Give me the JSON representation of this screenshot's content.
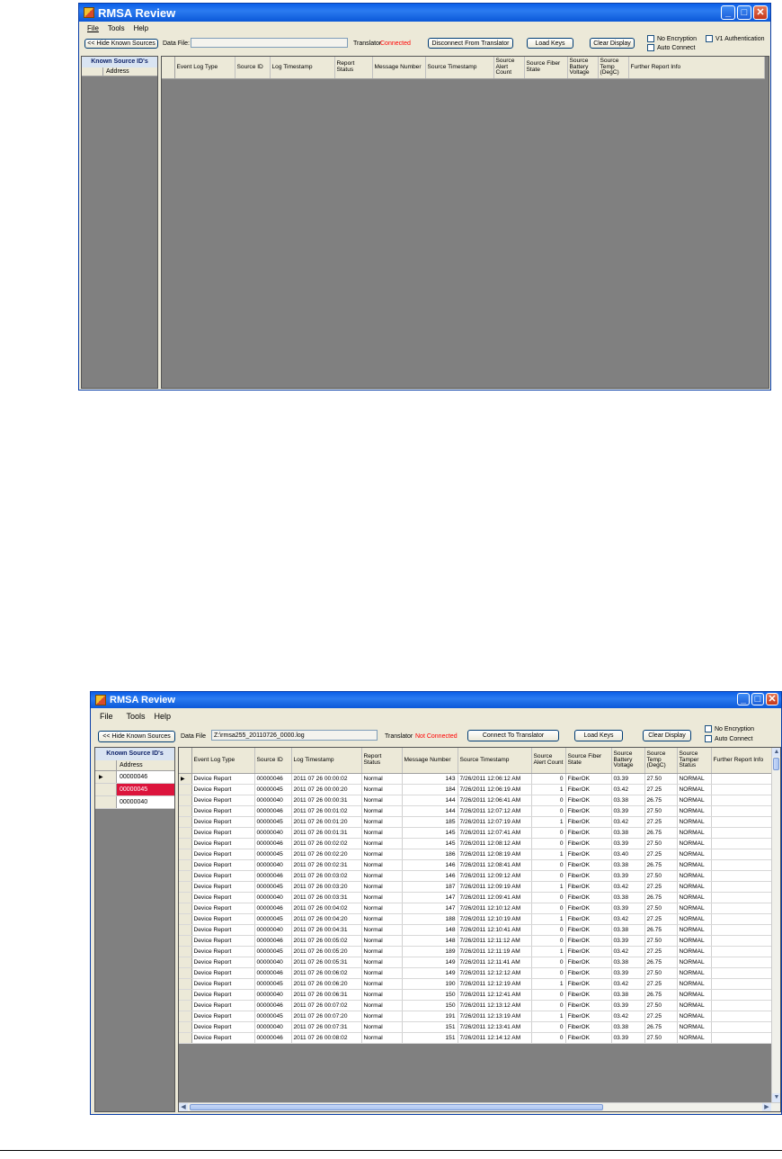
{
  "screen1": {
    "title": "RMSA Review",
    "menu": [
      "File",
      "Tools",
      "Help"
    ],
    "hide_button": "<< Hide Known Sources",
    "data_file_label": "Data File:",
    "data_file_value": "",
    "translator_label": "Translator",
    "translator_status": "Connected",
    "connect_button": "Disconnect From Translator",
    "load_keys": "Load Keys",
    "clear_display": "Clear Display",
    "no_encryption": "No Encryption",
    "auto_connect": "Auto Connect",
    "v1_auth": "V1 Authentication",
    "known_sources_title": "Known Source ID's",
    "address_header": "Address",
    "columns": [
      "Event Log Type",
      "Source ID",
      "Log Timestamp",
      "Report Status",
      "Message Number",
      "Source Timestamp",
      "Source Alert Count",
      "Source Fiber State",
      "Source Battery Voltage",
      "Source Temp (DegC)",
      "Further Report Info"
    ]
  },
  "screen2": {
    "title": "RMSA Review",
    "menu": [
      "File",
      "Tools",
      "Help"
    ],
    "hide_button": "<< Hide Known Sources",
    "data_file_label": "Data File",
    "data_file_value": "Z:\\rmsa255_20110726_0000.log",
    "translator_label": "Translator",
    "translator_status": "Not Connected",
    "connect_button": "Connect To Translator",
    "load_keys": "Load Keys",
    "clear_display": "Clear Display",
    "no_encryption": "No Encryption",
    "auto_connect": "Auto Connect",
    "known_sources_title": "Known Source ID's",
    "address_header": "Address",
    "sources": [
      "00000046",
      "00000045",
      "00000040"
    ],
    "columns": [
      "Event Log Type",
      "Source ID",
      "Log Timestamp",
      "Report Status",
      "Message Number",
      "Source Timestamp",
      "Source Alert Count",
      "Source Fiber State",
      "Source Battery Voltage",
      "Source Temp (DegC)",
      "Source Tamper Status",
      "Further Report Info"
    ],
    "rows": [
      [
        "Device Report",
        "00000046",
        "2011 07 26 00:00:02",
        "Normal",
        "143",
        "7/26/2011 12:06:12 AM",
        "0",
        "FiberOK",
        "03.39",
        "27.50",
        "NORMAL",
        ""
      ],
      [
        "Device Report",
        "00000045",
        "2011 07 26 00:00:20",
        "Normal",
        "184",
        "7/26/2011 12:06:19 AM",
        "1",
        "FiberOK",
        "03.42",
        "27.25",
        "NORMAL",
        ""
      ],
      [
        "Device Report",
        "00000040",
        "2011 07 26 00:00:31",
        "Normal",
        "144",
        "7/26/2011 12:06:41 AM",
        "0",
        "FiberOK",
        "03.38",
        "26.75",
        "NORMAL",
        ""
      ],
      [
        "Device Report",
        "00000046",
        "2011 07 26 00:01:02",
        "Normal",
        "144",
        "7/26/2011 12:07:12 AM",
        "0",
        "FiberOK",
        "03.39",
        "27.50",
        "NORMAL",
        ""
      ],
      [
        "Device Report",
        "00000045",
        "2011 07 26 00:01:20",
        "Normal",
        "185",
        "7/26/2011 12:07:19 AM",
        "1",
        "FiberOK",
        "03.42",
        "27.25",
        "NORMAL",
        ""
      ],
      [
        "Device Report",
        "00000040",
        "2011 07 26 00:01:31",
        "Normal",
        "145",
        "7/26/2011 12:07:41 AM",
        "0",
        "FiberOK",
        "03.38",
        "26.75",
        "NORMAL",
        ""
      ],
      [
        "Device Report",
        "00000046",
        "2011 07 26 00:02:02",
        "Normal",
        "145",
        "7/26/2011 12:08:12 AM",
        "0",
        "FiberOK",
        "03.39",
        "27.50",
        "NORMAL",
        ""
      ],
      [
        "Device Report",
        "00000045",
        "2011 07 26 00:02:20",
        "Normal",
        "186",
        "7/26/2011 12:08:19 AM",
        "1",
        "FiberOK",
        "03.40",
        "27.25",
        "NORMAL",
        ""
      ],
      [
        "Device Report",
        "00000040",
        "2011 07 26 00:02:31",
        "Normal",
        "146",
        "7/26/2011 12:08:41 AM",
        "0",
        "FiberOK",
        "03.38",
        "26.75",
        "NORMAL",
        ""
      ],
      [
        "Device Report",
        "00000046",
        "2011 07 26 00:03:02",
        "Normal",
        "146",
        "7/26/2011 12:09:12 AM",
        "0",
        "FiberOK",
        "03.39",
        "27.50",
        "NORMAL",
        ""
      ],
      [
        "Device Report",
        "00000045",
        "2011 07 26 00:03:20",
        "Normal",
        "187",
        "7/26/2011 12:09:19 AM",
        "1",
        "FiberOK",
        "03.42",
        "27.25",
        "NORMAL",
        ""
      ],
      [
        "Device Report",
        "00000040",
        "2011 07 26 00:03:31",
        "Normal",
        "147",
        "7/26/2011 12:09:41 AM",
        "0",
        "FiberOK",
        "03.38",
        "26.75",
        "NORMAL",
        ""
      ],
      [
        "Device Report",
        "00000046",
        "2011 07 26 00:04:02",
        "Normal",
        "147",
        "7/26/2011 12:10:12 AM",
        "0",
        "FiberOK",
        "03.39",
        "27.50",
        "NORMAL",
        ""
      ],
      [
        "Device Report",
        "00000045",
        "2011 07 26 00:04:20",
        "Normal",
        "188",
        "7/26/2011 12:10:19 AM",
        "1",
        "FiberOK",
        "03.42",
        "27.25",
        "NORMAL",
        ""
      ],
      [
        "Device Report",
        "00000040",
        "2011 07 26 00:04:31",
        "Normal",
        "148",
        "7/26/2011 12:10:41 AM",
        "0",
        "FiberOK",
        "03.38",
        "26.75",
        "NORMAL",
        ""
      ],
      [
        "Device Report",
        "00000046",
        "2011 07 26 00:05:02",
        "Normal",
        "148",
        "7/26/2011 12:11:12 AM",
        "0",
        "FiberOK",
        "03.39",
        "27.50",
        "NORMAL",
        ""
      ],
      [
        "Device Report",
        "00000045",
        "2011 07 26 00:05:20",
        "Normal",
        "189",
        "7/26/2011 12:11:19 AM",
        "1",
        "FiberOK",
        "03.42",
        "27.25",
        "NORMAL",
        ""
      ],
      [
        "Device Report",
        "00000040",
        "2011 07 26 00:05:31",
        "Normal",
        "149",
        "7/26/2011 12:11:41 AM",
        "0",
        "FiberOK",
        "03.38",
        "26.75",
        "NORMAL",
        ""
      ],
      [
        "Device Report",
        "00000046",
        "2011 07 26 00:06:02",
        "Normal",
        "149",
        "7/26/2011 12:12:12 AM",
        "0",
        "FiberOK",
        "03.39",
        "27.50",
        "NORMAL",
        ""
      ],
      [
        "Device Report",
        "00000045",
        "2011 07 26 00:06:20",
        "Normal",
        "190",
        "7/26/2011 12:12:19 AM",
        "1",
        "FiberOK",
        "03.42",
        "27.25",
        "NORMAL",
        ""
      ],
      [
        "Device Report",
        "00000040",
        "2011 07 26 00:06:31",
        "Normal",
        "150",
        "7/26/2011 12:12:41 AM",
        "0",
        "FiberOK",
        "03.38",
        "26.75",
        "NORMAL",
        ""
      ],
      [
        "Device Report",
        "00000046",
        "2011 07 26 00:07:02",
        "Normal",
        "150",
        "7/26/2011 12:13:12 AM",
        "0",
        "FiberOK",
        "03.39",
        "27.50",
        "NORMAL",
        ""
      ],
      [
        "Device Report",
        "00000045",
        "2011 07 26 00:07:20",
        "Normal",
        "191",
        "7/26/2011 12:13:19 AM",
        "1",
        "FiberOK",
        "03.42",
        "27.25",
        "NORMAL",
        ""
      ],
      [
        "Device Report",
        "00000040",
        "2011 07 26 00:07:31",
        "Normal",
        "151",
        "7/26/2011 12:13:41 AM",
        "0",
        "FiberOK",
        "03.38",
        "26.75",
        "NORMAL",
        ""
      ],
      [
        "Device Report",
        "00000046",
        "2011 07 26 00:08:02",
        "Normal",
        "151",
        "7/26/2011 12:14:12 AM",
        "0",
        "FiberOK",
        "03.39",
        "27.50",
        "NORMAL",
        ""
      ]
    ]
  }
}
